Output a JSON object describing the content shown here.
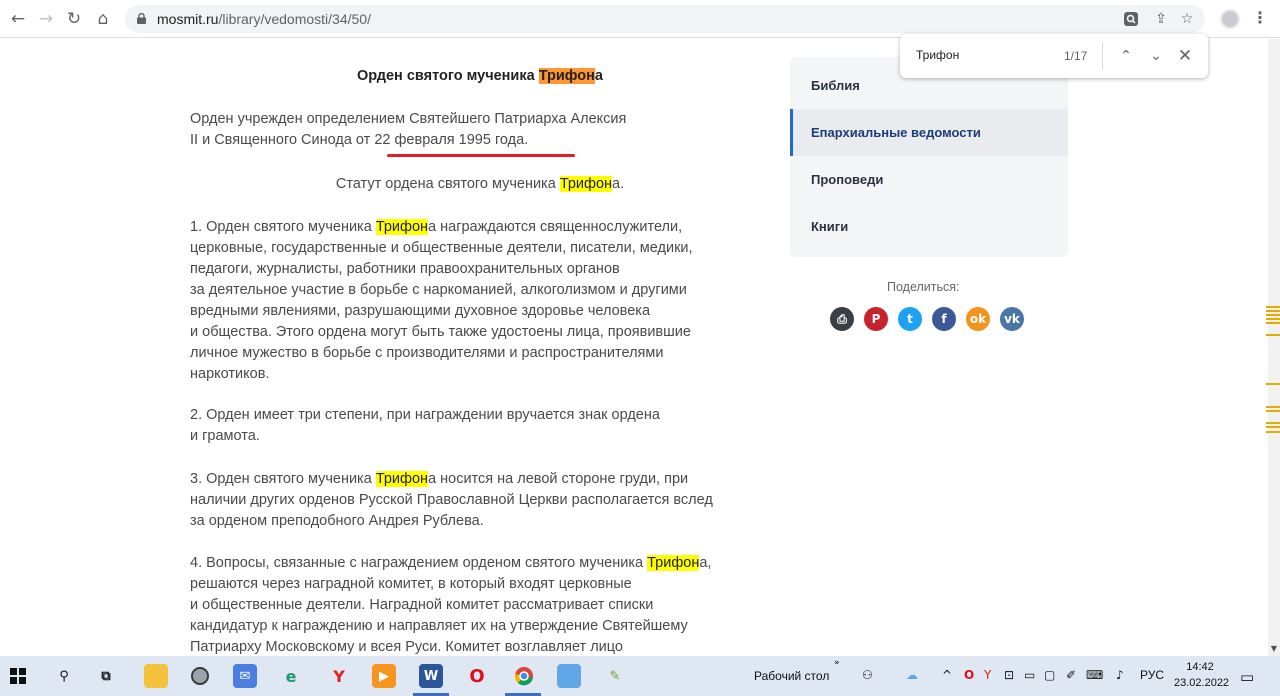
{
  "browser": {
    "url_host": "mosmit.ru",
    "url_path": "/library/vedomosti/34/50/"
  },
  "find": {
    "query": "Трифон",
    "count": "1/17"
  },
  "article": {
    "cut_line": "",
    "heading_pre": "Орден святого мученика ",
    "heading_mark": "Трифон",
    "heading_post": "а",
    "p1_line1": "Орден учрежден определением Святейшего Патриарха Алексия",
    "p1_line2": "II и Священного Синода от 22 февраля 1995 года.",
    "statute_pre": "Статут ордена святого мученика ",
    "statute_mark": "Трифон",
    "statute_post": "а.",
    "p2_pre": "1. Орден святого мученика ",
    "p2_mark": "Трифон",
    "p2_post": "а награждаются священнослужители,",
    "p2_lines": [
      "церковные, государственные и общественные деятели, писатели, медики,",
      "педагоги, журналисты, работники правоохранительных органов",
      "за деятельное участие в борьбе с наркоманией, алкоголизмом и другими",
      "вредными явлениями, разрушающими духовное здоровье человека",
      "и общества. Этого ордена могут быть также удостоены лица, проявившие",
      "личное мужество в борьбе с производителями и распространителями",
      "наркотиков."
    ],
    "p3_line1": "2. Орден имеет три степени, при награждении вручается знак ордена",
    "p3_line2": "и грамота.",
    "p4_pre": "3. Орден святого мученика ",
    "p4_mark": "Трифон",
    "p4_post": "а носится на левой стороне груди, при",
    "p4_line2": "наличии других орденов Русской Православной Церкви располагается вслед",
    "p4_line3": "за орденом преподобного Андрея Рублева.",
    "p5_pre": "4. Вопросы, связанные с награждением орденом святого мученика ",
    "p5_mark": "Трифон",
    "p5_post": "а,",
    "p5_lines": [
      "решаются через наградной комитет, в который входят церковные",
      "и общественные деятели. Наградной комитет рассматривает списки",
      "кандидатур к награждению и направляет их на утверждение Святейшему",
      "Патриарху Московскому и всея Руси. Комитет возглавляет лицо"
    ]
  },
  "sidebar": {
    "items": [
      {
        "label": "Библия"
      },
      {
        "label": "Епархиальные ведомости"
      },
      {
        "label": "Проповеди"
      },
      {
        "label": "Книги"
      }
    ],
    "share_label": "Поделиться:"
  },
  "taskbar": {
    "desktop_label": "Рабочий стол",
    "lang": "РУС",
    "time": "14:42",
    "date": "23.02.2022"
  },
  "colors": {
    "highlight": "#ffff00",
    "active_highlight": "#ff9632",
    "underline": "#e81c24",
    "sidebar_accent": "#1e6ad3"
  }
}
